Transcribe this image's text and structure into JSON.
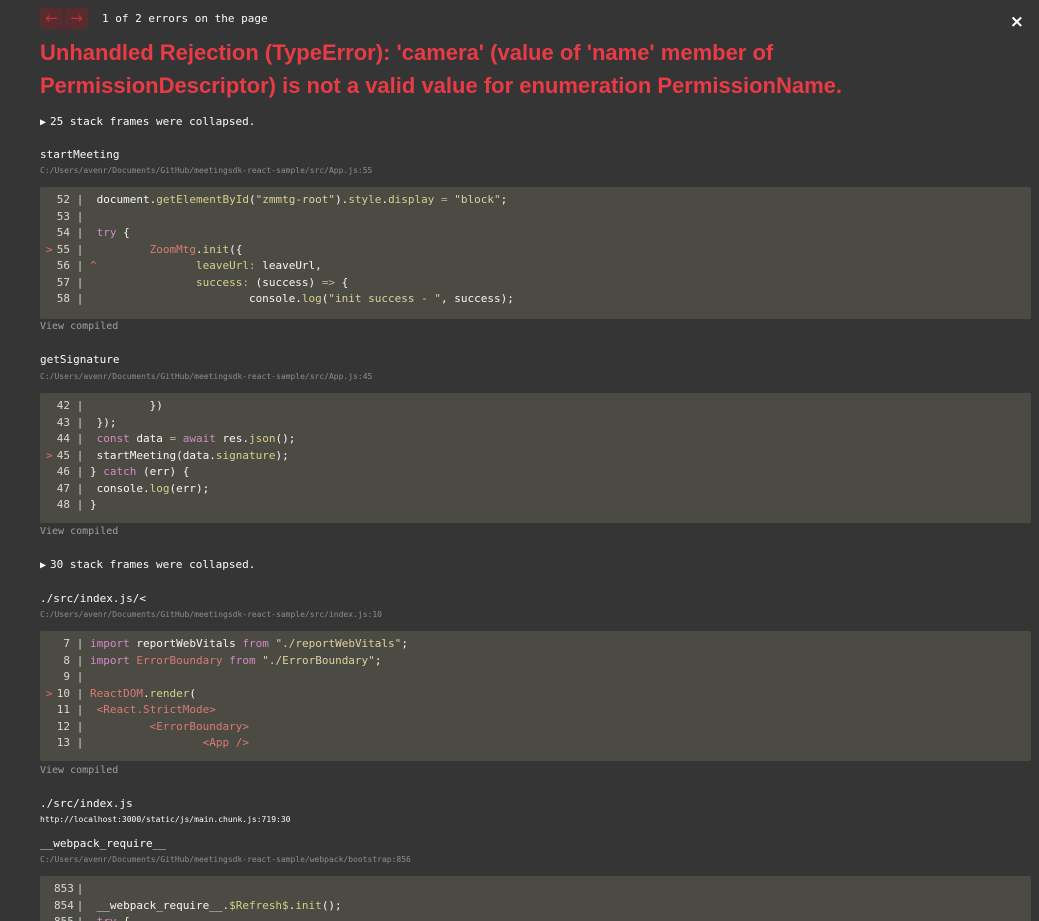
{
  "header": {
    "prev_label": "←",
    "next_label": "→",
    "error_count": "1 of 2 errors on the page",
    "close_label": "×"
  },
  "error": {
    "title": "Unhandled Rejection (TypeError): 'camera' (value of 'name' member of PermissionDescriptor) is not a valid value for enumeration PermissionName."
  },
  "collapsed_1": {
    "arrow": "▶",
    "text": "25 stack frames were collapsed."
  },
  "collapsed_2": {
    "arrow": "▶",
    "text": "30 stack frames were collapsed."
  },
  "frames": [
    {
      "name": "startMeeting",
      "location": "C:/Users/avenr/Documents/GitHub/meetingsdk-react-sample/src/App.js:55",
      "view_compiled": "View compiled"
    },
    {
      "name": "getSignature",
      "location": "C:/Users/avenr/Documents/GitHub/meetingsdk-react-sample/src/App.js:45",
      "view_compiled": "View compiled"
    },
    {
      "name": "./src/index.js/<",
      "location": "C:/Users/avenr/Documents/GitHub/meetingsdk-react-sample/src/index.js:10",
      "view_compiled": "View compiled"
    },
    {
      "name": "./src/index.js",
      "location": "http://localhost:3000/static/js/main.chunk.js:719:30"
    },
    {
      "name": "__webpack_require__",
      "location": "C:/Users/avenr/Documents/GitHub/meetingsdk-react-sample/webpack/bootstrap:856"
    }
  ],
  "code_blocks": [
    {
      "lines": [
        {
          "marker": " ",
          "num": "52",
          "tokens": [
            {
              "c": "code",
              "t": " document."
            },
            {
              "c": "d",
              "t": "getElementById"
            },
            {
              "c": "code",
              "t": "("
            },
            {
              "c": "s",
              "t": "\"zmmtg-root\""
            },
            {
              "c": "code",
              "t": ")."
            },
            {
              "c": "d",
              "t": "style"
            },
            {
              "c": "code",
              "t": "."
            },
            {
              "c": "d",
              "t": "display"
            },
            {
              "c": "code",
              "t": " "
            },
            {
              "c": "o",
              "t": "="
            },
            {
              "c": "code",
              "t": " "
            },
            {
              "c": "s",
              "t": "\"block\""
            },
            {
              "c": "code",
              "t": ";"
            }
          ]
        },
        {
          "marker": " ",
          "num": "53",
          "tokens": []
        },
        {
          "marker": " ",
          "num": "54",
          "tokens": [
            {
              "c": "code",
              "t": " "
            },
            {
              "c": "k",
              "t": "try"
            },
            {
              "c": "code",
              "t": " {"
            }
          ]
        },
        {
          "marker": ">",
          "num": "55",
          "tokens": [
            {
              "c": "code",
              "t": "         "
            },
            {
              "c": "t",
              "t": "ZoomMtg"
            },
            {
              "c": "code",
              "t": "."
            },
            {
              "c": "d",
              "t": "init"
            },
            {
              "c": "code",
              "t": "({"
            }
          ]
        },
        {
          "marker": " ",
          "num": "56",
          "tokens": [
            {
              "c": "marker",
              "t": "^"
            },
            {
              "c": "code",
              "t": "               "
            },
            {
              "c": "d",
              "t": "leaveUrl"
            },
            {
              "c": "o",
              "t": ":"
            },
            {
              "c": "code",
              "t": " leaveUrl,"
            }
          ]
        },
        {
          "marker": " ",
          "num": "57",
          "tokens": [
            {
              "c": "code",
              "t": "                "
            },
            {
              "c": "d",
              "t": "success"
            },
            {
              "c": "o",
              "t": ":"
            },
            {
              "c": "code",
              "t": " (success) "
            },
            {
              "c": "o",
              "t": "=>"
            },
            {
              "c": "code",
              "t": " {"
            }
          ]
        },
        {
          "marker": " ",
          "num": "58",
          "tokens": [
            {
              "c": "code",
              "t": "                        console."
            },
            {
              "c": "d",
              "t": "log"
            },
            {
              "c": "code",
              "t": "("
            },
            {
              "c": "s",
              "t": "\"init success - \""
            },
            {
              "c": "code",
              "t": ", success);"
            }
          ]
        }
      ]
    },
    {
      "lines": [
        {
          "marker": " ",
          "num": "42",
          "tokens": [
            {
              "c": "code",
              "t": "         })"
            }
          ]
        },
        {
          "marker": " ",
          "num": "43",
          "tokens": [
            {
              "c": "code",
              "t": " });"
            }
          ]
        },
        {
          "marker": " ",
          "num": "44",
          "tokens": [
            {
              "c": "code",
              "t": " "
            },
            {
              "c": "k",
              "t": "const"
            },
            {
              "c": "code",
              "t": " data "
            },
            {
              "c": "o",
              "t": "="
            },
            {
              "c": "code",
              "t": " "
            },
            {
              "c": "k",
              "t": "await"
            },
            {
              "c": "code",
              "t": " res."
            },
            {
              "c": "d",
              "t": "json"
            },
            {
              "c": "code",
              "t": "();"
            }
          ]
        },
        {
          "marker": ">",
          "num": "45",
          "tokens": [
            {
              "c": "code",
              "t": " startMeeting(data."
            },
            {
              "c": "d",
              "t": "signature"
            },
            {
              "c": "code",
              "t": ");"
            }
          ]
        },
        {
          "marker": " ",
          "num": "46",
          "tokens": [
            {
              "c": "code",
              "t": "} "
            },
            {
              "c": "k",
              "t": "catch"
            },
            {
              "c": "code",
              "t": " (err) {"
            }
          ]
        },
        {
          "marker": " ",
          "num": "47",
          "tokens": [
            {
              "c": "code",
              "t": " console."
            },
            {
              "c": "d",
              "t": "log"
            },
            {
              "c": "code",
              "t": "(err);"
            }
          ]
        },
        {
          "marker": " ",
          "num": "48",
          "tokens": [
            {
              "c": "code",
              "t": "}"
            }
          ]
        }
      ]
    },
    {
      "lines": [
        {
          "marker": " ",
          "num": "7",
          "tokens": [
            {
              "c": "k",
              "t": "import"
            },
            {
              "c": "code",
              "t": " reportWebVitals "
            },
            {
              "c": "k",
              "t": "from"
            },
            {
              "c": "code",
              "t": " "
            },
            {
              "c": "s",
              "t": "\"./reportWebVitals\""
            },
            {
              "c": "code",
              "t": ";"
            }
          ]
        },
        {
          "marker": " ",
          "num": "8",
          "tokens": [
            {
              "c": "k",
              "t": "import"
            },
            {
              "c": "code",
              "t": " "
            },
            {
              "c": "t",
              "t": "ErrorBoundary"
            },
            {
              "c": "code",
              "t": " "
            },
            {
              "c": "k",
              "t": "from"
            },
            {
              "c": "code",
              "t": " "
            },
            {
              "c": "s",
              "t": "\"./ErrorBoundary\""
            },
            {
              "c": "code",
              "t": ";"
            }
          ]
        },
        {
          "marker": " ",
          "num": "9",
          "tokens": []
        },
        {
          "marker": ">",
          "num": "10",
          "tokens": [
            {
              "c": "t",
              "t": "ReactDOM"
            },
            {
              "c": "code",
              "t": "."
            },
            {
              "c": "d",
              "t": "render"
            },
            {
              "c": "code",
              "t": "("
            }
          ]
        },
        {
          "marker": " ",
          "num": "11",
          "tokens": [
            {
              "c": "code",
              "t": " "
            },
            {
              "c": "t",
              "t": "<React.StrictMode>"
            }
          ]
        },
        {
          "marker": " ",
          "num": "12",
          "tokens": [
            {
              "c": "code",
              "t": "         "
            },
            {
              "c": "t",
              "t": "<ErrorBoundary>"
            }
          ]
        },
        {
          "marker": " ",
          "num": "13",
          "tokens": [
            {
              "c": "code",
              "t": "                 "
            },
            {
              "c": "t",
              "t": "<App />"
            }
          ]
        }
      ]
    },
    {
      "lines": [
        {
          "marker": " ",
          "num": "853",
          "tokens": []
        },
        {
          "marker": " ",
          "num": "854",
          "tokens": [
            {
              "c": "code",
              "t": " __webpack_require__."
            },
            {
              "c": "d",
              "t": "$Refresh$"
            },
            {
              "c": "code",
              "t": "."
            },
            {
              "c": "d",
              "t": "init"
            },
            {
              "c": "code",
              "t": "();"
            }
          ]
        },
        {
          "marker": " ",
          "num": "855",
          "tokens": [
            {
              "c": "code",
              "t": " "
            },
            {
              "c": "k",
              "t": "try"
            },
            {
              "c": "code",
              "t": " {"
            }
          ]
        }
      ]
    }
  ]
}
